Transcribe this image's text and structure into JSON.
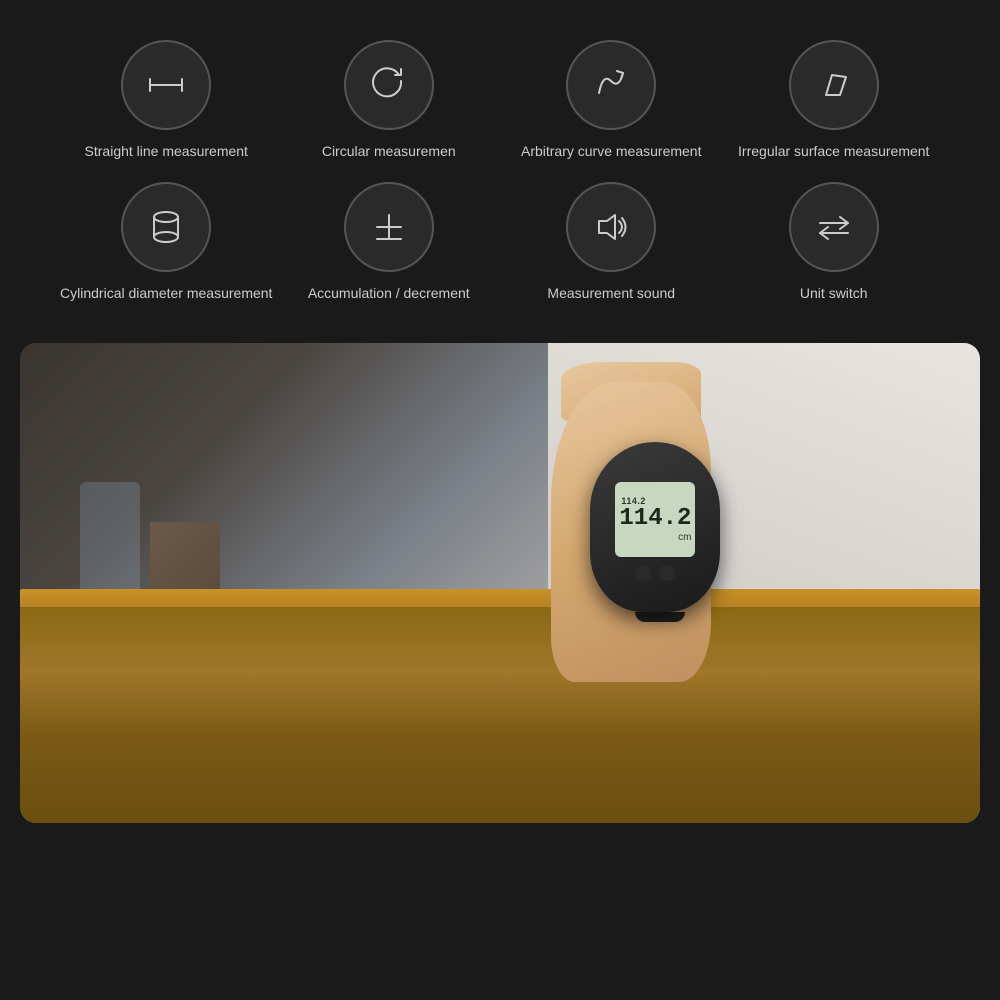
{
  "background_color": "#1a1a1a",
  "top_section": {
    "rows": [
      {
        "items": [
          {
            "id": "straight-line",
            "label": "Straight line\nmeasurement",
            "icon_type": "straight-line"
          },
          {
            "id": "circular",
            "label": "Circular\nmeasuremen",
            "icon_type": "circular"
          },
          {
            "id": "arbitrary-curve",
            "label": "Arbitrary curve\nmeasurement",
            "icon_type": "arbitrary-curve"
          },
          {
            "id": "irregular-surface",
            "label": "Irregular surface\nmeasurement",
            "icon_type": "irregular-surface"
          }
        ]
      },
      {
        "items": [
          {
            "id": "cylindrical",
            "label": "Cylindrical\ndiameter\nmeasurement",
            "icon_type": "cylindrical"
          },
          {
            "id": "accumulation",
            "label": "Accumulation /\ndecrement",
            "icon_type": "accumulation"
          },
          {
            "id": "sound",
            "label": "Measurement\nsound",
            "icon_type": "sound"
          },
          {
            "id": "unit-switch",
            "label": "Unit switch",
            "icon_type": "unit-switch"
          }
        ]
      }
    ]
  },
  "device": {
    "screen_top": "114.2",
    "screen_main": "114.2",
    "screen_unit": "cm"
  }
}
